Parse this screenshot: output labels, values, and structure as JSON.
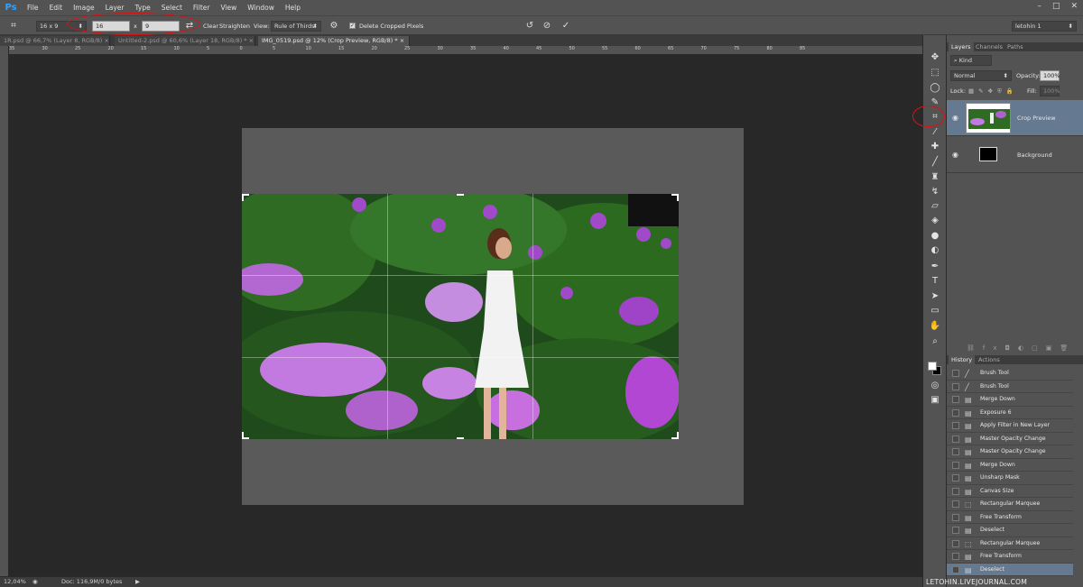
{
  "menu": {
    "logo": "Ps",
    "items": [
      "File",
      "Edit",
      "Image",
      "Layer",
      "Type",
      "Select",
      "Filter",
      "View",
      "Window",
      "Help"
    ],
    "window_controls": [
      "–",
      "□",
      "✕"
    ]
  },
  "options_bar": {
    "ratio_select": "16 x 9",
    "width_value": "16",
    "times_sign": "x",
    "height_value": "9",
    "clear_label": "Clear",
    "straighten_label": "Straighten",
    "view_label": "View:",
    "view_select": "Rule of Thirds",
    "delete_cropped_label": "Delete Cropped Pixels",
    "workspace_select": "letohin 1"
  },
  "tabs": [
    {
      "label": "1R.psd @ 66,7% (Layer 8, RGB/8)",
      "close": "×"
    },
    {
      "label": "Untitled-2.psd @ 60,6% (Layer 18, RGB/8) *",
      "close": "×"
    },
    {
      "label": "IMG_0519.psd @ 12% (Crop Preview, RGB/8) *",
      "close": "×"
    }
  ],
  "ruler_labels": [
    "35",
    "30",
    "25",
    "20",
    "15",
    "10",
    "5",
    "0",
    "5",
    "10",
    "15",
    "20",
    "25",
    "30",
    "35",
    "40",
    "45",
    "50",
    "55",
    "60",
    "65",
    "70",
    "75",
    "80",
    "85"
  ],
  "status": {
    "zoom": "12,04%",
    "doc": "Doc: 116,9M/0 bytes"
  },
  "layers_panel": {
    "tabs": [
      "Layers",
      "Channels",
      "Paths"
    ],
    "kind_label": "Kind",
    "blend_mode": "Normal",
    "opacity_label": "Opacity:",
    "opacity_value": "100%",
    "lock_label": "Lock:",
    "fill_label": "Fill:",
    "fill_value": "100%",
    "layers": [
      {
        "name": "Crop Preview",
        "selected": true
      },
      {
        "name": "Background",
        "selected": false
      }
    ]
  },
  "history_panel": {
    "tabs": [
      "History",
      "Actions"
    ],
    "items": [
      {
        "label": "Brush Tool",
        "icon": "brush-icon"
      },
      {
        "label": "Brush Tool",
        "icon": "brush-icon"
      },
      {
        "label": "Merge Down",
        "icon": "doc-icon"
      },
      {
        "label": "Exposure 6",
        "icon": "doc-icon"
      },
      {
        "label": "Apply Filter in New Layer",
        "icon": "doc-icon"
      },
      {
        "label": "Master Opacity Change",
        "icon": "doc-icon"
      },
      {
        "label": "Master Opacity Change",
        "icon": "doc-icon"
      },
      {
        "label": "Merge Down",
        "icon": "doc-icon"
      },
      {
        "label": "Unsharp Mask",
        "icon": "doc-icon"
      },
      {
        "label": "Canvas Size",
        "icon": "doc-icon"
      },
      {
        "label": "Rectangular Marquee",
        "icon": "marquee-icon"
      },
      {
        "label": "Free Transform",
        "icon": "doc-icon"
      },
      {
        "label": "Deselect",
        "icon": "doc-icon"
      },
      {
        "label": "Rectangular Marquee",
        "icon": "marquee-icon"
      },
      {
        "label": "Free Transform",
        "icon": "doc-icon"
      },
      {
        "label": "Deselect",
        "icon": "doc-icon",
        "selected": true
      }
    ]
  },
  "watermark": "LETOHIN.LIVEJOURNAL.COM",
  "colors": {
    "accent_selected": "#657990",
    "annotation_red": "#dd1111",
    "ps_blue": "#2fa3ff"
  }
}
